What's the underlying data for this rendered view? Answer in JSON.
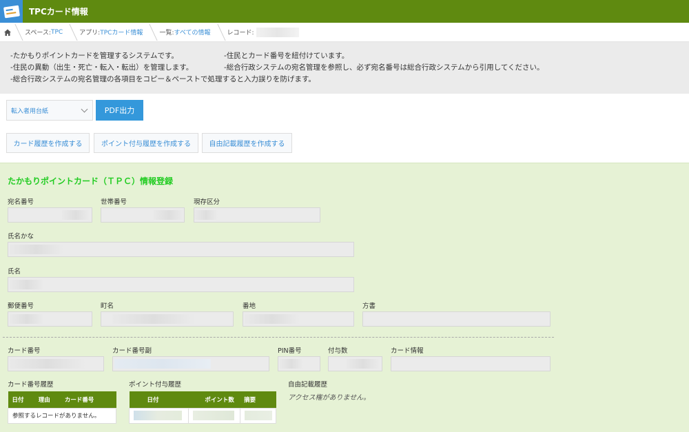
{
  "app": {
    "title": "TPCカード情報",
    "icon": "card-icon"
  },
  "breadcrumb": {
    "space_label": "スペース: ",
    "space_link": "TPC",
    "app_label": "アプリ: ",
    "app_link": "TPCカード情報",
    "list_label": "一覧: ",
    "list_link": "すべての情報",
    "record_label": "レコード: "
  },
  "description": {
    "line1a": "-たかもりポイントカードを管理するシステムです。",
    "line1b": "-住民とカード番号を紐付けています。",
    "line2a": "-住民の異動（出生・死亡・転入・転出）を管理します。",
    "line2b": "-総合行政システムの宛名管理を参照し、必ず宛名番号は総合行政システムから引用してください。",
    "line3": "-総合行政システムの宛名管理の各項目をコピー＆ペーストで処理すると入力誤りを防げます。"
  },
  "toolbar": {
    "template_select": "転入者用台紙",
    "pdf_button": "PDF出力",
    "card_history_button": "カード履歴を作成する",
    "point_history_button": "ポイント付与履歴を作成する",
    "free_history_button": "自由記載履歴を作成する"
  },
  "form": {
    "title": "たかもりポイントカード（ＴＰＣ）情報登録",
    "labels": {
      "atena": "宛名番号",
      "setai": "世帯番号",
      "genzon": "現存区分",
      "kana": "氏名かな",
      "name": "氏名",
      "postal": "郵便番号",
      "town": "町名",
      "banchi": "番地",
      "gata": "方書",
      "card_no": "カード番号",
      "card_no_sub": "カード番号副",
      "pin": "PIN番号",
      "points": "付与数",
      "card_info": "カード情報",
      "card_history": "カード番号履歴",
      "point_history": "ポイント付与履歴",
      "free_history": "自由記載履歴"
    },
    "card_history_table": {
      "columns": [
        "日付",
        "理由",
        "カード番号"
      ],
      "empty_message": "参照するレコードがありません。"
    },
    "point_history_table": {
      "columns": [
        "日付",
        "ポイント数",
        "摘要"
      ]
    },
    "free_history_message": "アクセス権がありません。"
  },
  "colors": {
    "header": "#5f8a10",
    "accent": "#3498db",
    "form_bg": "#e6f2d5",
    "title_green": "#22cc22"
  }
}
